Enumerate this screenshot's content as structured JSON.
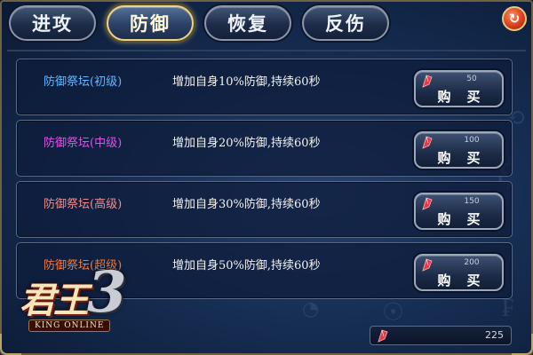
{
  "tabs": [
    {
      "label": "进攻",
      "active": false
    },
    {
      "label": "防御",
      "active": true
    },
    {
      "label": "恢复",
      "active": false
    },
    {
      "label": "反伤",
      "active": false
    }
  ],
  "close_button": {
    "icon": "refresh-close-icon",
    "color": "#d8401d"
  },
  "items": [
    {
      "name": "防御祭坛(初级)",
      "name_color": "#5fb8ff",
      "description": "增加自身10%防御,持续60秒",
      "price": "50",
      "buy_label": "购买"
    },
    {
      "name": "防御祭坛(中级)",
      "name_color": "#e050e8",
      "description": "增加自身20%防御,持续60秒",
      "price": "100",
      "buy_label": "购买"
    },
    {
      "name": "防御祭坛(高级)",
      "name_color": "#f08c8c",
      "description": "增加自身30%防御,持续60秒",
      "price": "150",
      "buy_label": "购买"
    },
    {
      "name": "防御祭坛(超级)",
      "name_color": "#f07a3a",
      "description": "增加自身50%防御,持续60秒",
      "price": "200",
      "buy_label": "购买"
    }
  ],
  "logo": {
    "main": "君王",
    "number": "3",
    "subtitle": "KING ONLINE"
  },
  "currency": {
    "icon": "red-gem-icon",
    "value": "225"
  }
}
